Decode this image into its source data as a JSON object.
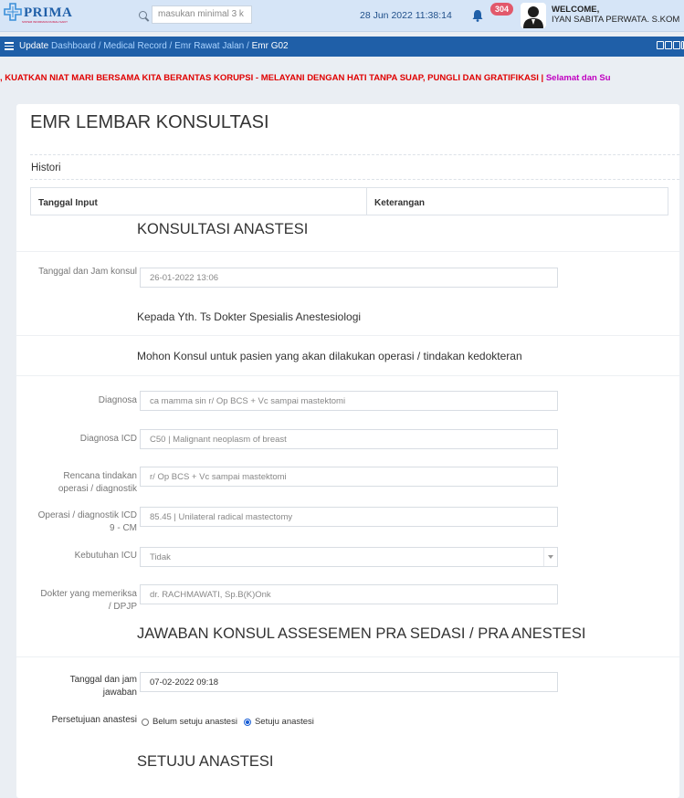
{
  "header": {
    "logo_text": "PRIMA",
    "logo_sub": "SISTEM INFORMASI RUMAH SAKIT",
    "search_placeholder": "masukan minimal 3 k",
    "datetime": "28 Jun 2022 11:38:14",
    "notification_count": "304",
    "welcome_label": "WELCOME,",
    "user_name": "IYAN SABITA PERWATA. S.KOM"
  },
  "breadcrumb": {
    "prefix": "Update",
    "items": [
      "Dashboard /",
      "Medical Record /",
      "Emr Rawat Jalan /"
    ],
    "current": "Emr G02"
  },
  "marquee": {
    "red_text": ", KUATKAN NIAT MARI BERSAMA KITA BERANTAS KORUPSI - MELAYANI DENGAN HATI TANPA SUAP, PUNGLI DAN GRATIFIKASI |",
    "purple_text": "Selamat dan Su"
  },
  "page": {
    "title": "EMR LEMBAR KONSULTASI",
    "histori_label": "Histori",
    "table_headers": [
      "Tanggal Input",
      "Keterangan"
    ]
  },
  "konsul": {
    "heading": "KONSULTASI ANASTESI",
    "tanggal_label": "Tanggal dan Jam konsul",
    "tanggal_value": "26-01-2022 13:06",
    "kepada_text": "Kepada Yth. Ts Dokter Spesialis Anestesiologi",
    "mohon_text": "Mohon Konsul untuk pasien yang akan dilakukan operasi / tindakan kedokteran",
    "diagnosa_label": "Diagnosa",
    "diagnosa_value": "ca mamma sin r/ Op BCS + Vc sampai mastektomi",
    "icd_label": "Diagnosa ICD",
    "icd_value": "C50 | Malignant neoplasm of breast",
    "rencana_label": "Rencana tindakan operasi / diagnostik",
    "rencana_value": "r/ Op BCS + Vc sampai mastektomi",
    "icd9_label": "Operasi / diagnostik ICD 9 - CM",
    "icd9_value": "85.45 | Unilateral radical mastectomy",
    "icu_label": "Kebutuhan ICU",
    "icu_value": "Tidak",
    "dokter_label": "Dokter yang memeriksa / DPJP",
    "dokter_value": "dr. RACHMAWATI, Sp.B(K)Onk"
  },
  "jawaban": {
    "heading": "JAWABAN KONSUL ASSESEMEN PRA SEDASI / PRA ANESTESI",
    "tanggal_label": "Tanggal dan jam jawaban",
    "tanggal_value": "07-02-2022 09:18",
    "persetujuan_label": "Persetujuan anastesi",
    "option_belum": "Belum setuju anastesi",
    "option_setuju": "Setuju anastesi",
    "selected": "Setuju anastesi",
    "result_heading": "SETUJU ANASTESI"
  }
}
